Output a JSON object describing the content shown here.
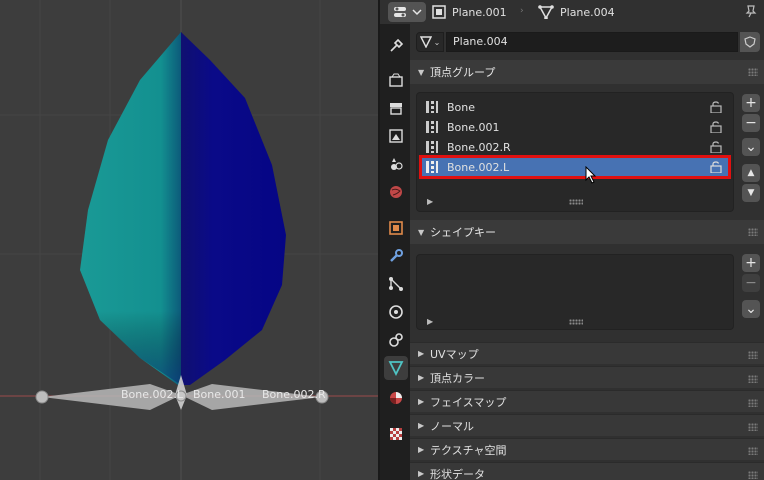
{
  "viewport": {
    "bones": [
      {
        "label": "Bone.002.L"
      },
      {
        "label": "Bone.001"
      },
      {
        "label": "Bone.002.R"
      }
    ]
  },
  "header": {
    "object_name": "Plane.001",
    "mesh_name": "Plane.004"
  },
  "datablock": {
    "name": "Plane.004"
  },
  "vertex_groups": {
    "title": "頂点グループ",
    "items": [
      {
        "label": "Bone"
      },
      {
        "label": "Bone.001"
      },
      {
        "label": "Bone.002.R"
      },
      {
        "label": "Bone.002.L"
      }
    ],
    "selected_index": 3
  },
  "shape_keys": {
    "title": "シェイプキー"
  },
  "side_buttons": {
    "add": "+",
    "remove": "−",
    "menu": "⌄",
    "up": "▲",
    "down": "▼"
  },
  "collapsed_panels": [
    {
      "label": "UVマップ"
    },
    {
      "label": "頂点カラー"
    },
    {
      "label": "フェイスマップ"
    },
    {
      "label": "ノーマル"
    },
    {
      "label": "テクスチャ空間"
    },
    {
      "label": "形状データ"
    }
  ],
  "colors": {
    "selected_row": "#4772b3",
    "highlight_box": "#e01010",
    "mesh_left": "#1a9a96",
    "mesh_right": "#0a0a8a",
    "active_tab_icon": "#4fc4c4"
  }
}
